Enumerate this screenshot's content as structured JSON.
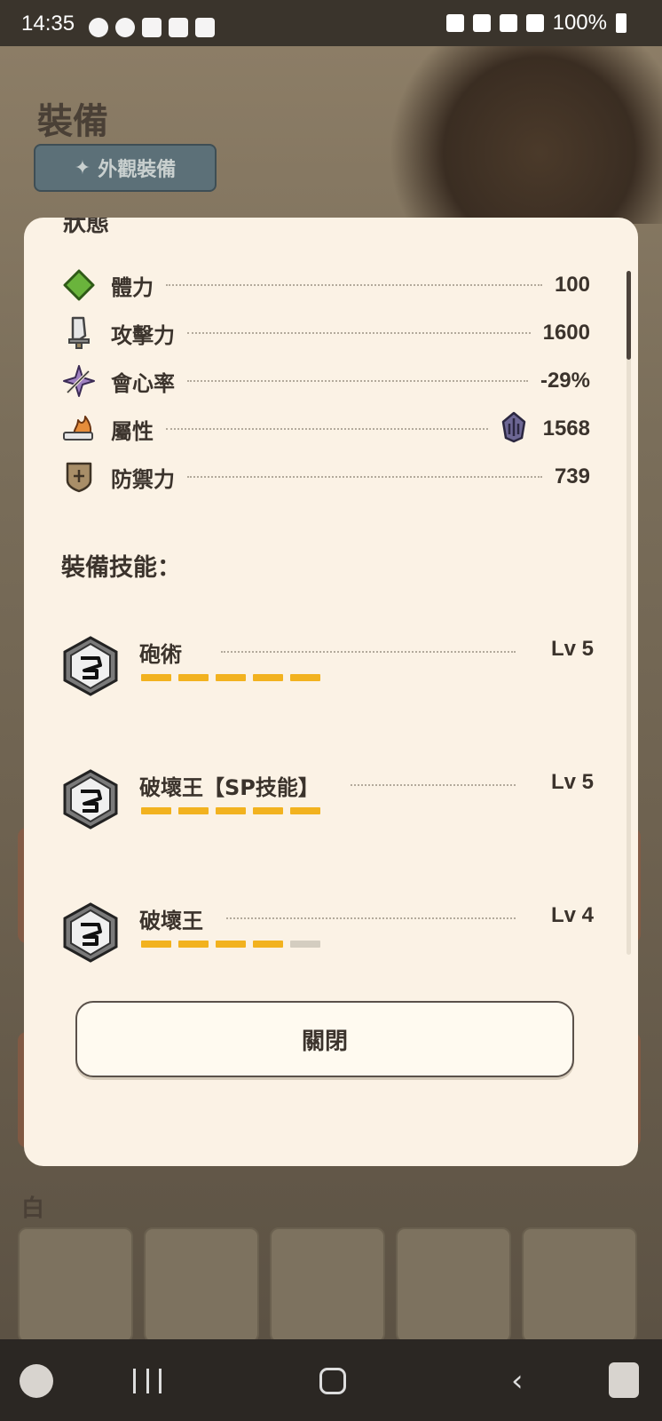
{
  "status_bar": {
    "time": "14:35",
    "battery": "100%",
    "left_icons": [
      "whatsapp-icon",
      "messenger-icon",
      "gmail-icon",
      "gallery-icon",
      "shopping-bag-icon"
    ],
    "right_icons": [
      "mute-vibrate-icon",
      "location-icon",
      "wifi-icon",
      "signal-icon",
      "battery-icon"
    ]
  },
  "background_app": {
    "title": "裝備",
    "appearance_button": "外觀裝備",
    "lower_label": "白"
  },
  "modal": {
    "cut_heading": "狀態",
    "stats": [
      {
        "label": "體力",
        "value": "100",
        "icon": "health-diamond-icon",
        "color": "#6ab43c"
      },
      {
        "label": "攻擊力",
        "value": "1600",
        "icon": "attack-blade-icon",
        "color": "#9b9b9b"
      },
      {
        "label": "會心率",
        "value": "-29%",
        "icon": "affinity-crossed-swords-icon",
        "color": "#a081c2"
      },
      {
        "label": "屬性",
        "value": "1568",
        "icon": "element-flame-blade-icon",
        "color": "#e58d3b",
        "element_icon": "dragon-element-icon"
      },
      {
        "label": "防禦力",
        "value": "739",
        "icon": "defense-shield-icon",
        "color": "#9c8563"
      }
    ],
    "skills_heading": "裝備技能：",
    "skills": [
      {
        "name": "砲術",
        "level": "Lv 5",
        "filled": 5,
        "max": 5
      },
      {
        "name": "破壞王【SP技能】",
        "level": "Lv 5",
        "filled": 5,
        "max": 5
      },
      {
        "name": "破壞王",
        "level": "Lv 4",
        "filled": 4,
        "max": 5
      }
    ],
    "close_label": "關閉"
  },
  "colors": {
    "modal_bg": "#fbf2e5",
    "skill_bar_filled": "#f2b21f",
    "skill_bar_empty": "#d4cdc0",
    "text_dark": "#3b332c"
  }
}
